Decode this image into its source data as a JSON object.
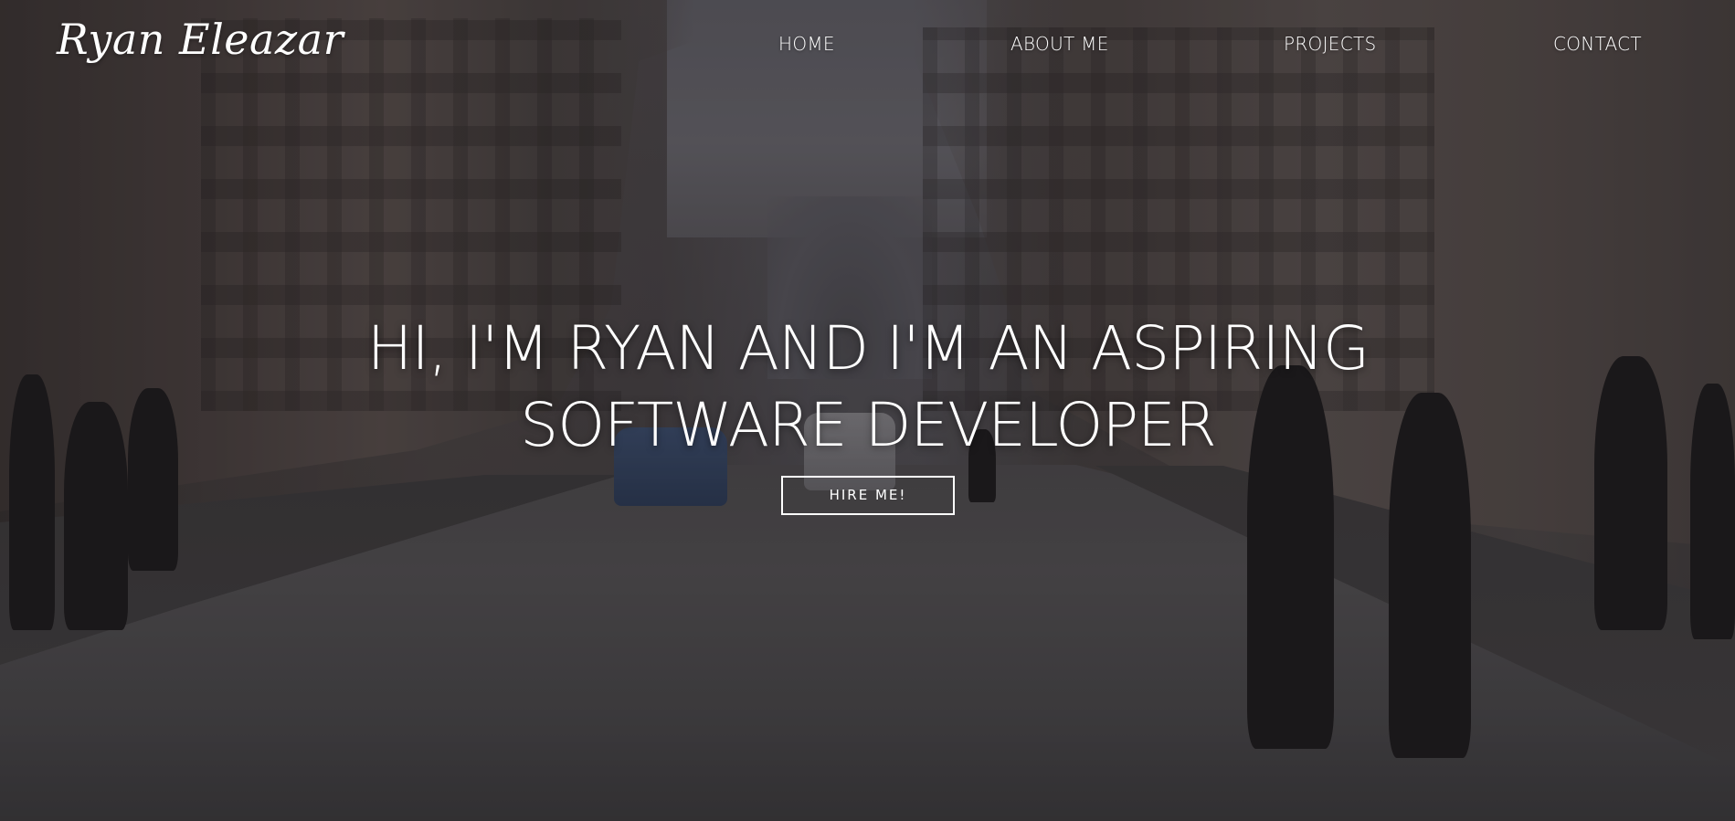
{
  "header": {
    "logo_text": "Ryan Eleazar"
  },
  "nav": {
    "items": [
      {
        "label": "HOME"
      },
      {
        "label": "ABOUT ME"
      },
      {
        "label": "PROJECTS"
      },
      {
        "label": "CONTACT"
      }
    ]
  },
  "hero": {
    "headline_line1": "HI, I'M RYAN AND I'M AN ASPIRING",
    "headline_line2": "SOFTWARE DEVELOPER",
    "cta_label": "HIRE ME!",
    "background_image": "city-street-photo"
  },
  "colors": {
    "text": "#ffffff",
    "overlay": "#141214"
  }
}
